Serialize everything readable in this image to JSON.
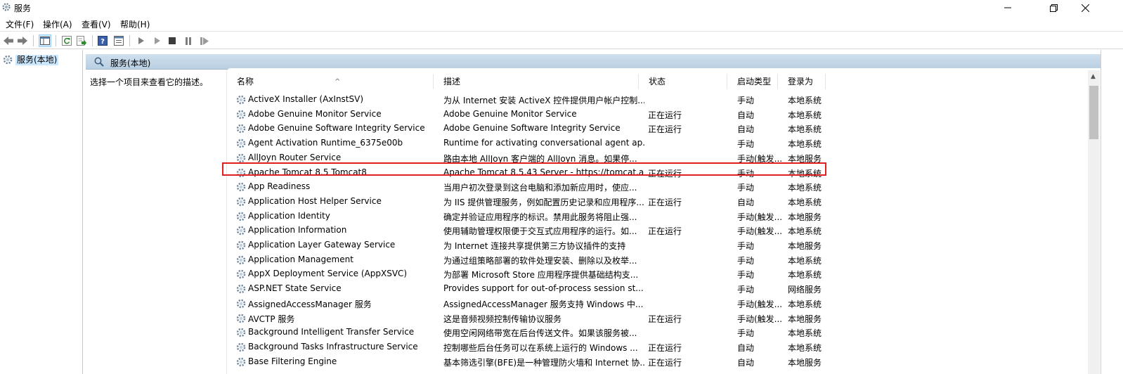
{
  "window": {
    "title": "服务"
  },
  "menu": [
    "文件(F)",
    "操作(A)",
    "查看(V)",
    "帮助(H)"
  ],
  "tree": {
    "root_label": "服务(本地)"
  },
  "pane": {
    "header": "服务(本地)",
    "description_prompt": "选择一个项目来查看它的描述。"
  },
  "columns": {
    "name": "名称",
    "desc": "描述",
    "status": "状态",
    "startup": "启动类型",
    "logon": "登录为"
  },
  "rows": [
    {
      "name": "ActiveX Installer (AxInstSV)",
      "desc": "为从 Internet 安装 ActiveX 控件提供用户帐户控制...",
      "status": "",
      "startup": "手动",
      "logon": "本地系统"
    },
    {
      "name": "Adobe Genuine Monitor Service",
      "desc": "Adobe Genuine Monitor Service",
      "status": "正在运行",
      "startup": "自动",
      "logon": "本地系统"
    },
    {
      "name": "Adobe Genuine Software Integrity Service",
      "desc": "Adobe Genuine Software Integrity Service",
      "status": "正在运行",
      "startup": "自动",
      "logon": "本地系统"
    },
    {
      "name": "Agent Activation Runtime_6375e00b",
      "desc": "Runtime for activating conversational agent ap...",
      "status": "",
      "startup": "手动",
      "logon": "本地系统"
    },
    {
      "name": "AllJoyn Router Service",
      "desc": "路由本地 AllJoyn 客户端的 AllJoyn 消息。如果停...",
      "status": "",
      "startup": "手动(触发...",
      "logon": "本地服务"
    },
    {
      "name": "Apache Tomcat 8.5 Tomcat8",
      "desc": "Apache Tomcat 8.5.43 Server - https://tomcat.a...",
      "status": "正在运行",
      "startup": "手动",
      "logon": "本地系统"
    },
    {
      "name": "App Readiness",
      "desc": "当用户初次登录到这台电脑和添加新应用时，使应...",
      "status": "",
      "startup": "手动",
      "logon": "本地系统"
    },
    {
      "name": "Application Host Helper Service",
      "desc": "为 IIS 提供管理服务，例如配置历史记录和应用程序...",
      "status": "正在运行",
      "startup": "自动",
      "logon": "本地系统"
    },
    {
      "name": "Application Identity",
      "desc": "确定并验证应用程序的标识。禁用此服务将阻止强...",
      "status": "",
      "startup": "手动(触发...",
      "logon": "本地服务"
    },
    {
      "name": "Application Information",
      "desc": "使用辅助管理权限便于交互式应用程序的运行。如...",
      "status": "正在运行",
      "startup": "手动(触发...",
      "logon": "本地系统"
    },
    {
      "name": "Application Layer Gateway Service",
      "desc": "为 Internet 连接共享提供第三方协议插件的支持",
      "status": "",
      "startup": "手动",
      "logon": "本地服务"
    },
    {
      "name": "Application Management",
      "desc": "为通过组策略部署的软件处理安装、删除以及枚举...",
      "status": "",
      "startup": "手动",
      "logon": "本地系统"
    },
    {
      "name": "AppX Deployment Service (AppXSVC)",
      "desc": "为部署 Microsoft Store 应用程序提供基础结构支...",
      "status": "",
      "startup": "手动",
      "logon": "本地系统"
    },
    {
      "name": "ASP.NET State Service",
      "desc": "Provides support for out-of-process session st...",
      "status": "",
      "startup": "手动",
      "logon": "网络服务"
    },
    {
      "name": "AssignedAccessManager 服务",
      "desc": "AssignedAccessManager 服务支持 Windows 中...",
      "status": "",
      "startup": "手动(触发...",
      "logon": "本地系统"
    },
    {
      "name": "AVCTP 服务",
      "desc": "这是音频视频控制传输协议服务",
      "status": "正在运行",
      "startup": "手动(触发...",
      "logon": "本地服务"
    },
    {
      "name": "Background Intelligent Transfer Service",
      "desc": "使用空闲网络带宽在后台传送文件。如果该服务被...",
      "status": "",
      "startup": "手动",
      "logon": "本地系统"
    },
    {
      "name": "Background Tasks Infrastructure Service",
      "desc": "控制哪些后台任务可以在系统上运行的 Windows ...",
      "status": "正在运行",
      "startup": "自动",
      "logon": "本地系统"
    },
    {
      "name": "Base Filtering Engine",
      "desc": "基本筛选引擎(BFE)是一种管理防火墙和 Internet 协...",
      "status": "正在运行",
      "startup": "自动",
      "logon": "本地服务"
    }
  ],
  "highlighted_row_index": 5
}
